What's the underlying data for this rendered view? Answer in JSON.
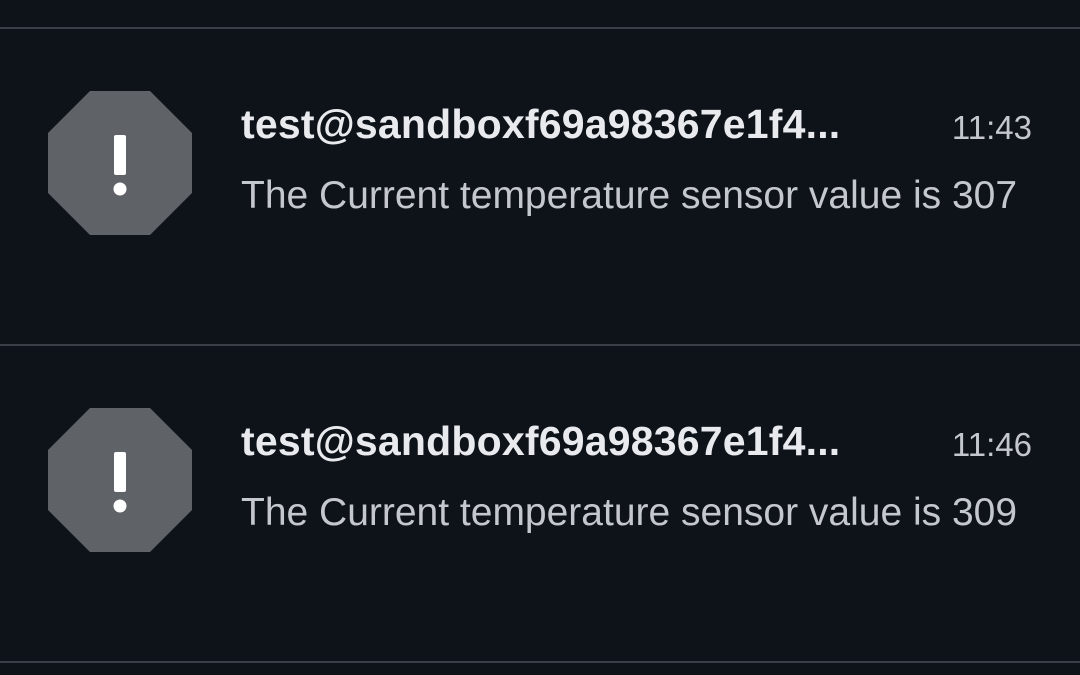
{
  "notifications": [
    {
      "sender": "test@sandboxf69a98367e1f4...",
      "time": "11:43",
      "message": "The Current temperature sensor value is 307",
      "icon": "alert-octagon-icon"
    },
    {
      "sender": "test@sandboxf69a98367e1f4...",
      "time": "11:46",
      "message": "The Current temperature sensor value is 309",
      "icon": "alert-octagon-icon"
    }
  ],
  "colors": {
    "background": "#0e131a",
    "divider": "#3a3f47",
    "icon_fill": "#5f6368",
    "icon_glyph": "#ffffff",
    "title_text": "#e8eaed",
    "body_text": "#c4c7cc"
  }
}
